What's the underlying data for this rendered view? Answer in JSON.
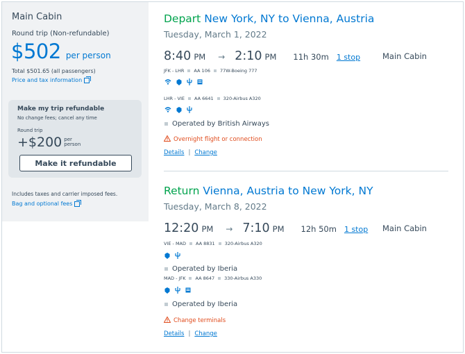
{
  "summary": {
    "cabin": "Main Cabin",
    "trip_type": "Round trip (Non-refundable)",
    "price": "$502",
    "per_person": "per person",
    "total": "Total $501.65 (all passengers)",
    "tax_link": "Price and tax information",
    "fees_note": "Includes taxes and carrier imposed fees.",
    "bag_link": "Bag and optional fees"
  },
  "refund_card": {
    "title": "Make my trip refundable",
    "subtitle": "No change fees; cancel any time",
    "round_trip": "Round trip",
    "price": "+$200",
    "per_line1": "per",
    "per_line2": "person",
    "button": "Make it refundable"
  },
  "depart": {
    "kind": "Depart",
    "route": "New York, NY to Vienna, Austria",
    "date": "Tuesday, March 1, 2022",
    "dep_time": "8:40",
    "dep_ampm": "PM",
    "arr_time": "2:10",
    "arr_ampm": "PM",
    "arrow": "→",
    "duration": "11h 30m",
    "stops": "1 stop",
    "cabin": "Main Cabin",
    "leg1": {
      "route": "JFK - LHR",
      "flight": "AA 106",
      "aircraft": "77W-Boeing 777"
    },
    "leg2": {
      "route": "LHR - VIE",
      "flight": "AA 6641",
      "aircraft": "320-Airbus A320"
    },
    "operated": "Operated by British Airways",
    "warning": "Overnight flight or connection",
    "details_link": "Details",
    "change_link": "Change",
    "separator": "|"
  },
  "return": {
    "kind": "Return",
    "route": "Vienna, Austria to New York, NY",
    "date": "Tuesday, March 8, 2022",
    "dep_time": "12:20",
    "dep_ampm": "PM",
    "arr_time": "7:10",
    "arr_ampm": "PM",
    "arrow": "→",
    "duration": "12h 50m",
    "stops": "1 stop",
    "cabin": "Main Cabin",
    "leg1": {
      "route": "VIE - MAD",
      "flight": "AA 8831",
      "aircraft": "320-Airbus A320"
    },
    "operated1": "Operated by Iberia",
    "leg2": {
      "route": "MAD - JFK",
      "flight": "AA 8647",
      "aircraft": "330-Airbus A330"
    },
    "operated2": "Operated by Iberia",
    "warning": "Change terminals",
    "details_link": "Details",
    "change_link": "Change",
    "separator": "|"
  },
  "icons": {
    "wifi": "wifi-icon",
    "entertainment": "entertainment-icon",
    "power": "power-icon",
    "screen": "seatback-screen-icon",
    "warning": "warning-icon",
    "external": "external-link-icon"
  },
  "colors": {
    "accent": "#0078d2",
    "green": "#00a34d",
    "warning": "#e04b1c",
    "text": "#36495a"
  }
}
